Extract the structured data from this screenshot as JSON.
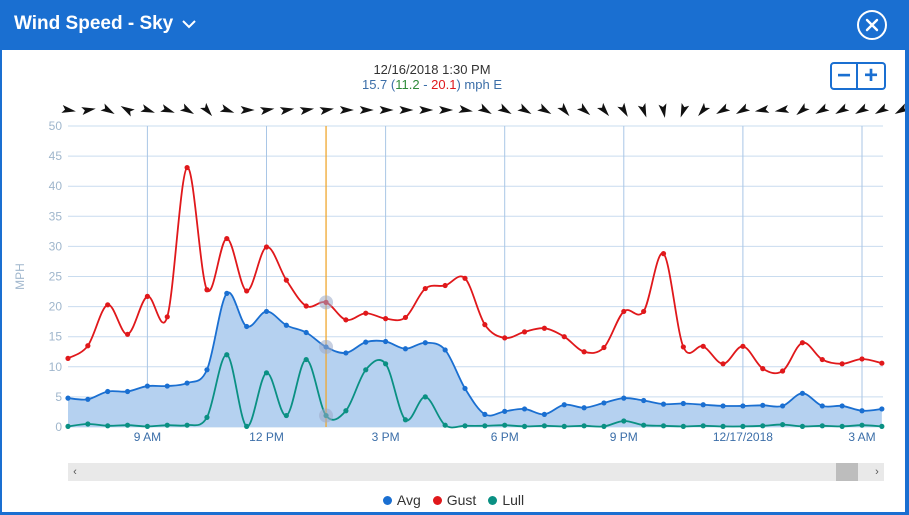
{
  "window": {
    "title": "Wind Speed - Sky",
    "title_icon": "chevron-down-icon",
    "close_icon": "close-icon"
  },
  "readout": {
    "datetime": "12/16/2018 1:30 PM",
    "avg": "15.7",
    "lull": "11.2",
    "gust": "20.1",
    "unit_dir": "mph E"
  },
  "zoom": {
    "out_label": "−",
    "in_label": "+"
  },
  "scrollbar": {
    "left_label": "‹",
    "right_label": "›"
  },
  "colors": {
    "avg": "#1a6fd1",
    "gust": "#e0181b",
    "lull": "#0a9083",
    "avg_fill": "#b5d1f0",
    "cursor": "#f0a830",
    "accent": "#1a6fd1"
  },
  "chart_data": {
    "type": "area",
    "ylabel": "MPH",
    "ylim": [
      0,
      50
    ],
    "yticks": [
      "0",
      "5",
      "10",
      "15",
      "20",
      "25",
      "30",
      "35",
      "40",
      "45",
      "50"
    ],
    "xtick_labels": [
      "9 AM",
      "12 PM",
      "3 PM",
      "6 PM",
      "9 PM",
      "12/17/2018",
      "3 AM"
    ],
    "x_hours_start": 7.0,
    "cursor_time": "1:30 PM",
    "series": [
      {
        "name": "Avg",
        "values": [
          4.8,
          4.6,
          5.9,
          5.9,
          6.8,
          6.8,
          7.3,
          9.5,
          22.2,
          16.7,
          19.2,
          16.9,
          15.7,
          13.3,
          12.3,
          14.1,
          14.2,
          13.0,
          14.0,
          12.8,
          6.4,
          2.1,
          2.6,
          3.0,
          2.1,
          3.7,
          3.2,
          4.0,
          4.8,
          4.4,
          3.8,
          3.9,
          3.7,
          3.5,
          3.5,
          3.6,
          3.5,
          5.6,
          3.5,
          3.5,
          2.7,
          3.0
        ]
      },
      {
        "name": "Gust",
        "values": [
          11.4,
          13.5,
          20.3,
          15.4,
          21.7,
          18.3,
          43.1,
          22.8,
          31.3,
          22.6,
          29.9,
          24.4,
          20.1,
          20.7,
          17.8,
          18.9,
          18.0,
          18.2,
          23.0,
          23.5,
          24.7,
          17.0,
          14.8,
          15.8,
          16.4,
          15.0,
          12.5,
          13.2,
          19.2,
          19.2,
          28.8,
          13.3,
          13.4,
          10.5,
          13.4,
          9.7,
          9.3,
          14.0,
          11.2,
          10.5,
          11.3,
          10.6
        ]
      },
      {
        "name": "Lull",
        "values": [
          0.1,
          0.5,
          0.2,
          0.3,
          0.1,
          0.3,
          0.3,
          1.6,
          12.0,
          0.1,
          9.0,
          1.9,
          11.2,
          1.9,
          2.7,
          9.5,
          10.5,
          1.2,
          5.0,
          0.3,
          0.2,
          0.2,
          0.3,
          0.1,
          0.2,
          0.1,
          0.2,
          0.1,
          1.0,
          0.3,
          0.2,
          0.1,
          0.2,
          0.1,
          0.1,
          0.2,
          0.4,
          0.1,
          0.2,
          0.1,
          0.3,
          0.1
        ]
      }
    ],
    "wind_direction_deg": [
      100,
      80,
      120,
      300,
      110,
      110,
      120,
      140,
      110,
      90,
      80,
      80,
      80,
      80,
      90,
      90,
      90,
      90,
      90,
      90,
      100,
      120,
      120,
      120,
      120,
      140,
      130,
      140,
      150,
      160,
      170,
      200,
      220,
      240,
      240,
      260,
      260,
      230,
      240,
      240,
      240,
      240,
      240
    ]
  }
}
